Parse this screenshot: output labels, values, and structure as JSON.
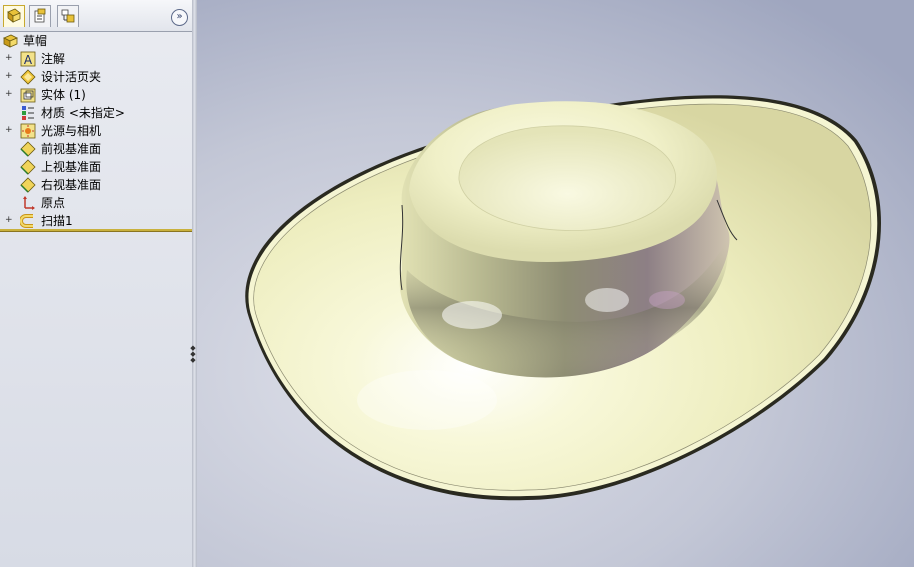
{
  "panel": {
    "tabs": [
      {
        "name": "feature-manager-tab",
        "active": true
      },
      {
        "name": "property-manager-tab",
        "active": false
      },
      {
        "name": "configuration-manager-tab",
        "active": false
      }
    ],
    "collapse_glyph": "»"
  },
  "tree": {
    "root": {
      "label": "草帽",
      "icon": "part-icon"
    },
    "items": [
      {
        "label": "注解",
        "icon": "annotations-icon",
        "expandable": true
      },
      {
        "label": "设计活页夹",
        "icon": "design-binder-icon",
        "expandable": true
      },
      {
        "label": "实体 (1)",
        "icon": "solid-bodies-icon",
        "expandable": true
      },
      {
        "label": "材质 <未指定>",
        "icon": "material-icon",
        "expandable": false
      },
      {
        "label": "光源与相机",
        "icon": "lights-cameras-icon",
        "expandable": true
      },
      {
        "label": "前视基准面",
        "icon": "plane-icon",
        "expandable": false
      },
      {
        "label": "上视基准面",
        "icon": "plane-icon",
        "expandable": false
      },
      {
        "label": "右视基准面",
        "icon": "plane-icon",
        "expandable": false
      },
      {
        "label": "原点",
        "icon": "origin-icon",
        "expandable": false
      },
      {
        "label": "扫描1",
        "icon": "sweep-icon",
        "expandable": true
      }
    ]
  },
  "viewport": {
    "model": "straw-hat-3d-model",
    "model_color": "#f2f2c6",
    "background_color": "#c3c7d6"
  }
}
